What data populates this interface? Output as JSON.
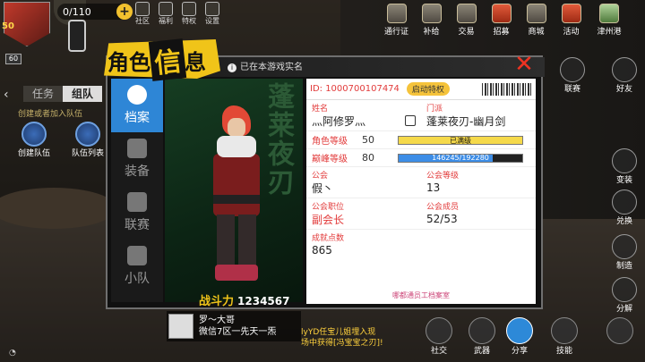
{
  "hud": {
    "level": "50",
    "stamina": "0/110",
    "sub_level": "60",
    "top_icons": [
      "社区",
      "福利",
      "特权",
      "设置"
    ],
    "right_menu": [
      "通行证",
      "补给",
      "交易",
      "招募",
      "商城",
      "活动",
      "津州港"
    ],
    "mini_text": [
      "联赛",
      "好友"
    ]
  },
  "left": {
    "tabs": [
      "任务",
      "组队"
    ],
    "note": "创建或者加入队伍",
    "buttons": [
      "创建队伍",
      "队伍列表"
    ]
  },
  "right_side": [
    "变装",
    "兑换",
    "制造",
    "分解"
  ],
  "modal": {
    "title_pre": "角色",
    "title_hl": "信",
    "title_post": "息",
    "realname_notice": "已在本游戏实名",
    "close": "✕",
    "nav": [
      "档案",
      "装备",
      "联赛",
      "小队"
    ],
    "portrait_text": "蓬莱夜刃",
    "power_label": "战斗力",
    "power_value": "1234567",
    "card": {
      "id_text": "ID: 1000700107474",
      "wechat_label": "启动特权",
      "name_label": "姓名",
      "name_value": "灬阿修罗灬",
      "school_label": "门派",
      "school_value": "蓬莱夜刃-幽月剑",
      "role_level_label": "角色等级",
      "role_level_value": "50",
      "role_level_bar_text": "已满级",
      "role_level_fill": 1.0,
      "peak_level_label": "巅峰等级",
      "peak_level_value": "80",
      "peak_bar_text": "146245/192280",
      "peak_fill": 0.76,
      "guild_label": "公会",
      "guild_value": "假丶",
      "guild_level_label": "公会等级",
      "guild_level_value": "13",
      "guild_pos_label": "公会职位",
      "guild_pos_value": "副会长",
      "guild_member_label": "公会成员",
      "guild_member_value": "52/53",
      "achieve_label": "成就点数",
      "achieve_value": "865",
      "watermark": "哪都通员工档案室"
    }
  },
  "chat": {
    "line1": "罗～大哥",
    "line2": "微信7区一先天一炁"
  },
  "system_msg": {
    "line1": "lyYD任宝儿姐埋入现",
    "line2": "场中获得[冯宝宝之刃]!"
  },
  "bottom": [
    "社交",
    "武器",
    "分享",
    "技能"
  ],
  "colors": {
    "accent": "#2e86d6",
    "title": "#f0c419",
    "label": "#e23b3b",
    "level_bar": "#f5d94a",
    "peak_bar": "#3d8de6"
  }
}
